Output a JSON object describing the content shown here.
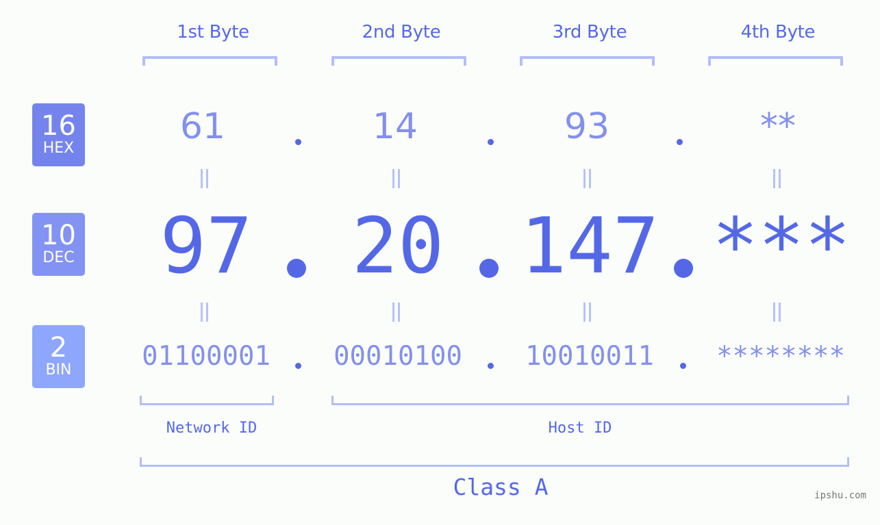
{
  "bytes": {
    "headers": [
      "1st Byte",
      "2nd Byte",
      "3rd Byte",
      "4th Byte"
    ]
  },
  "bases": {
    "hex": {
      "number": "16",
      "label": "HEX",
      "color": "#7584ec"
    },
    "dec": {
      "number": "10",
      "label": "DEC",
      "color": "#8393f3"
    },
    "bin": {
      "number": "2",
      "label": "BIN",
      "color": "#8ea6fb"
    }
  },
  "values": {
    "hex": [
      "61",
      "14",
      "93",
      "**"
    ],
    "dec": [
      "97",
      "20",
      "147",
      "***"
    ],
    "bin": [
      "01100001",
      "00010100",
      "10010011",
      "********"
    ]
  },
  "labels": {
    "network_id": "Network ID",
    "host_id": "Host ID",
    "class": "Class A"
  },
  "watermark": "ipshu.com",
  "colors": {
    "accent": "#5468e7",
    "secondary": "#8390ec",
    "bracket": "#b3bdf7",
    "background": "#fbfdfb"
  }
}
